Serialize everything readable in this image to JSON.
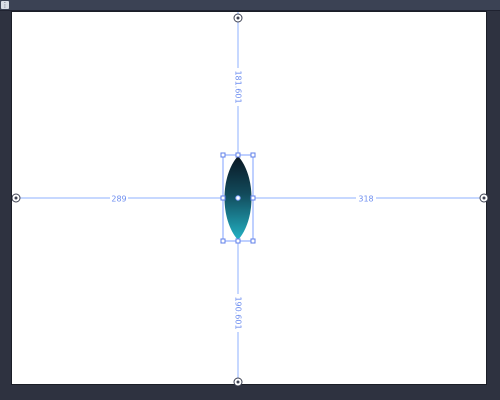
{
  "window": {
    "accent_color": "#5b8cff",
    "frame_color": "#2e3240",
    "canvas_color": "#ffffff"
  },
  "toolbar": {
    "menu_icon": "grid-icon"
  },
  "selection": {
    "shape": "lens",
    "gradient": [
      "#0b1e2a",
      "#1aa3b5"
    ]
  },
  "measurements": {
    "top": "181.601",
    "bottom": "190.601",
    "left": "289",
    "right": "318"
  }
}
